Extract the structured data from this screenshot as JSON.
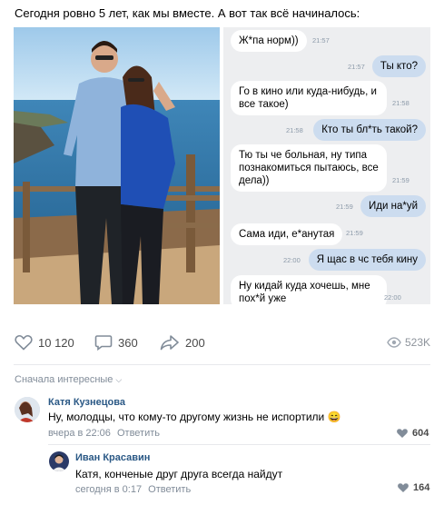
{
  "post": {
    "text": "Сегодня ровно 5 лет, как мы вместе. А вот так всё начиналось:"
  },
  "chat": {
    "messages": [
      {
        "text": "Ж*па норм))",
        "time": "21:57",
        "side": "in"
      },
      {
        "text": "Ты кто?",
        "time": "21:57",
        "side": "out"
      },
      {
        "text": "Го в кино или куда-нибудь, и все такое)",
        "time": "21:58",
        "side": "in"
      },
      {
        "text": "Кто ты бл*ть такой?",
        "time": "21:58",
        "side": "out"
      },
      {
        "text": "Тю ты че больная, ну типа познакомиться пытаюсь, все дела))",
        "time": "21:59",
        "side": "in"
      },
      {
        "text": "Иди на*уй",
        "time": "21:59",
        "side": "out"
      },
      {
        "text": "Сама иди, е*анутая",
        "time": "21:59",
        "side": "in"
      },
      {
        "text": "Я щас в чс тебя кину",
        "time": "22:00",
        "side": "out"
      },
      {
        "text": "Ну кидай куда хочешь, мне пох*й уже",
        "time": "22:00",
        "side": "in"
      }
    ]
  },
  "actions": {
    "likes": "10 120",
    "comments": "360",
    "shares": "200",
    "views": "523K"
  },
  "comments_sort": "Сначала интересные",
  "comments": [
    {
      "name": "Катя Кузнецова",
      "text": "Ну, молодцы, что кому-то другому жизнь не испортили",
      "emoji": "😄",
      "time": "вчера в 22:06",
      "reply": "Ответить",
      "likes": "604"
    },
    {
      "name": "Иван Красавин",
      "text": "Катя, конченые друг друга всегда найдут",
      "time": "сегодня в 0:17",
      "reply": "Ответить",
      "likes": "164"
    }
  ],
  "colors": {
    "link": "#2a5885",
    "meta": "#818c99",
    "chat_bg": "#edeef0",
    "bubble_out": "#ccdcef"
  }
}
